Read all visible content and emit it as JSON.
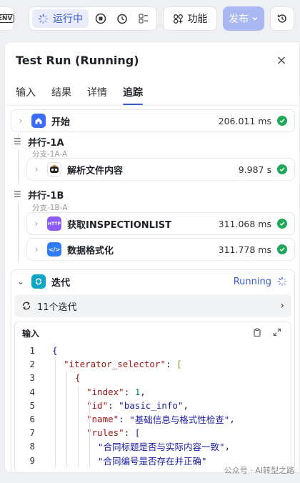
{
  "toolbar": {
    "env_label": "ENV",
    "running_label": "运行中",
    "function_label": "功能",
    "publish_label": "发布"
  },
  "panel": {
    "title": "Test Run (Running)",
    "tabs": [
      {
        "label": "输入"
      },
      {
        "label": "结果"
      },
      {
        "label": "详情"
      },
      {
        "label": "追踪",
        "active": true
      }
    ]
  },
  "trace": {
    "start": {
      "name": "开始",
      "time": "206.011 ms"
    },
    "group_a": {
      "label": "并行-1A",
      "branch": "分支-1A-A"
    },
    "node_parse": {
      "name": "解析文件内容",
      "time": "9.987 s"
    },
    "group_b": {
      "label": "并行-1B",
      "branch": "分支-1B-A"
    },
    "node_http": {
      "name": "获取INSPECTIONLIST",
      "time": "311.068 ms",
      "icon_text": "HTTP"
    },
    "node_format": {
      "name": "数据格式化",
      "time": "311.778 ms",
      "icon_text": "</>"
    },
    "iterate": {
      "name": "迭代",
      "status": "Running",
      "count_label": "11个迭代",
      "input_title": "输入"
    }
  },
  "code_lines": [
    {
      "n": "1",
      "indent": 0,
      "parts": [
        {
          "t": "{",
          "c": "tk-p"
        }
      ]
    },
    {
      "n": "2",
      "indent": 1,
      "parts": [
        {
          "t": "\"iterator_selector\"",
          "c": "tk-k"
        },
        {
          "t": ": ",
          "c": ""
        },
        {
          "t": "[",
          "c": "tk-g"
        }
      ]
    },
    {
      "n": "3",
      "indent": 2,
      "parts": [
        {
          "t": "{",
          "c": "tk-k"
        }
      ]
    },
    {
      "n": "4",
      "indent": 3,
      "parts": [
        {
          "t": "\"index\"",
          "c": "tk-k"
        },
        {
          "t": ": ",
          "c": ""
        },
        {
          "t": "1",
          "c": "tk-n"
        },
        {
          "t": ",",
          "c": ""
        }
      ]
    },
    {
      "n": "5",
      "indent": 3,
      "parts": [
        {
          "t": "\"id\"",
          "c": "tk-k"
        },
        {
          "t": ": ",
          "c": ""
        },
        {
          "t": "\"basic_info\"",
          "c": "tk-p"
        },
        {
          "t": ",",
          "c": ""
        }
      ]
    },
    {
      "n": "6",
      "indent": 3,
      "parts": [
        {
          "t": "\"name\"",
          "c": "tk-k"
        },
        {
          "t": ": ",
          "c": ""
        },
        {
          "t": "\"基础信息与格式性检查\"",
          "c": "tk-p"
        },
        {
          "t": ",",
          "c": ""
        }
      ]
    },
    {
      "n": "7",
      "indent": 3,
      "parts": [
        {
          "t": "\"rules\"",
          "c": "tk-k"
        },
        {
          "t": ": ",
          "c": ""
        },
        {
          "t": "[",
          "c": "tk-p"
        }
      ]
    },
    {
      "n": "8",
      "indent": 4,
      "parts": [
        {
          "t": "\"合同标题是否与实际内容一致\"",
          "c": "tk-p"
        },
        {
          "t": ",",
          "c": ""
        }
      ]
    },
    {
      "n": "9",
      "indent": 4,
      "parts": [
        {
          "t": "\"合同编号是否存在并正确\"",
          "c": "tk-p"
        }
      ]
    }
  ],
  "watermark": "公众号 · AI转型之路"
}
